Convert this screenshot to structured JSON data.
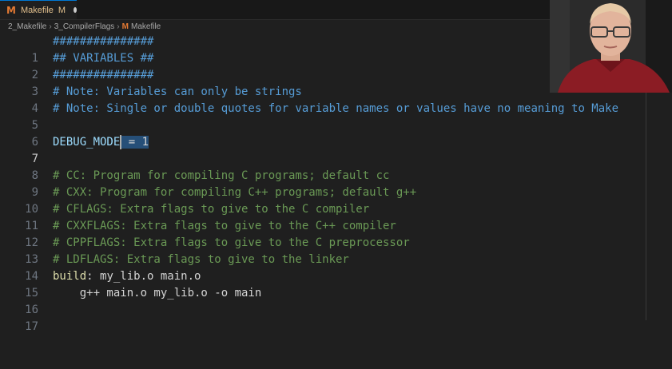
{
  "tab": {
    "icon": "M",
    "filename": "Makefile",
    "status": "M"
  },
  "breadcrumb": {
    "folder1": "2_Makefile",
    "folder2": "3_CompilerFlags",
    "file_icon": "M",
    "file": "Makefile"
  },
  "editor": {
    "lines": [
      {
        "n": "1",
        "text": "###############"
      },
      {
        "n": "2",
        "text": "## VARIABLES ##"
      },
      {
        "n": "3",
        "text": "###############"
      },
      {
        "n": "4",
        "text": "# Note: Variables can only be strings"
      },
      {
        "n": "5",
        "text": "# Note: Single or double quotes for variable names or values have no meaning to Make"
      },
      {
        "n": "6",
        "text": ""
      },
      {
        "n": "7",
        "var": "DEBUG_MODE",
        "sel": " = ",
        "val": "1"
      },
      {
        "n": "8",
        "text": ""
      },
      {
        "n": "9",
        "text": "# CC: Program for compiling C programs; default cc"
      },
      {
        "n": "10",
        "text": "# CXX: Program for compiling C++ programs; default g++"
      },
      {
        "n": "11",
        "text": "# CFLAGS: Extra flags to give to the C compiler"
      },
      {
        "n": "12",
        "text": "# CXXFLAGS: Extra flags to give to the C++ compiler"
      },
      {
        "n": "13",
        "text": "# CPPFLAGS: Extra flags to give to the C preprocessor"
      },
      {
        "n": "14",
        "text": "# LDFLAGS: Extra flags to give to the linker"
      },
      {
        "n": "15",
        "target": "build",
        "deps": ": my_lib.o main.o"
      },
      {
        "n": "16",
        "text": "    g++ main.o my_lib.o -o main"
      },
      {
        "n": "17",
        "text": ""
      }
    ]
  },
  "colors": {
    "comment": "#6a9955",
    "hash_header": "#569cd6",
    "variable": "#9cdcfe",
    "selection": "#264f78",
    "modified": "#e2c08d"
  },
  "icons": {
    "makefile": "makefile-icon",
    "unsaved": "unsaved-dot-icon"
  }
}
